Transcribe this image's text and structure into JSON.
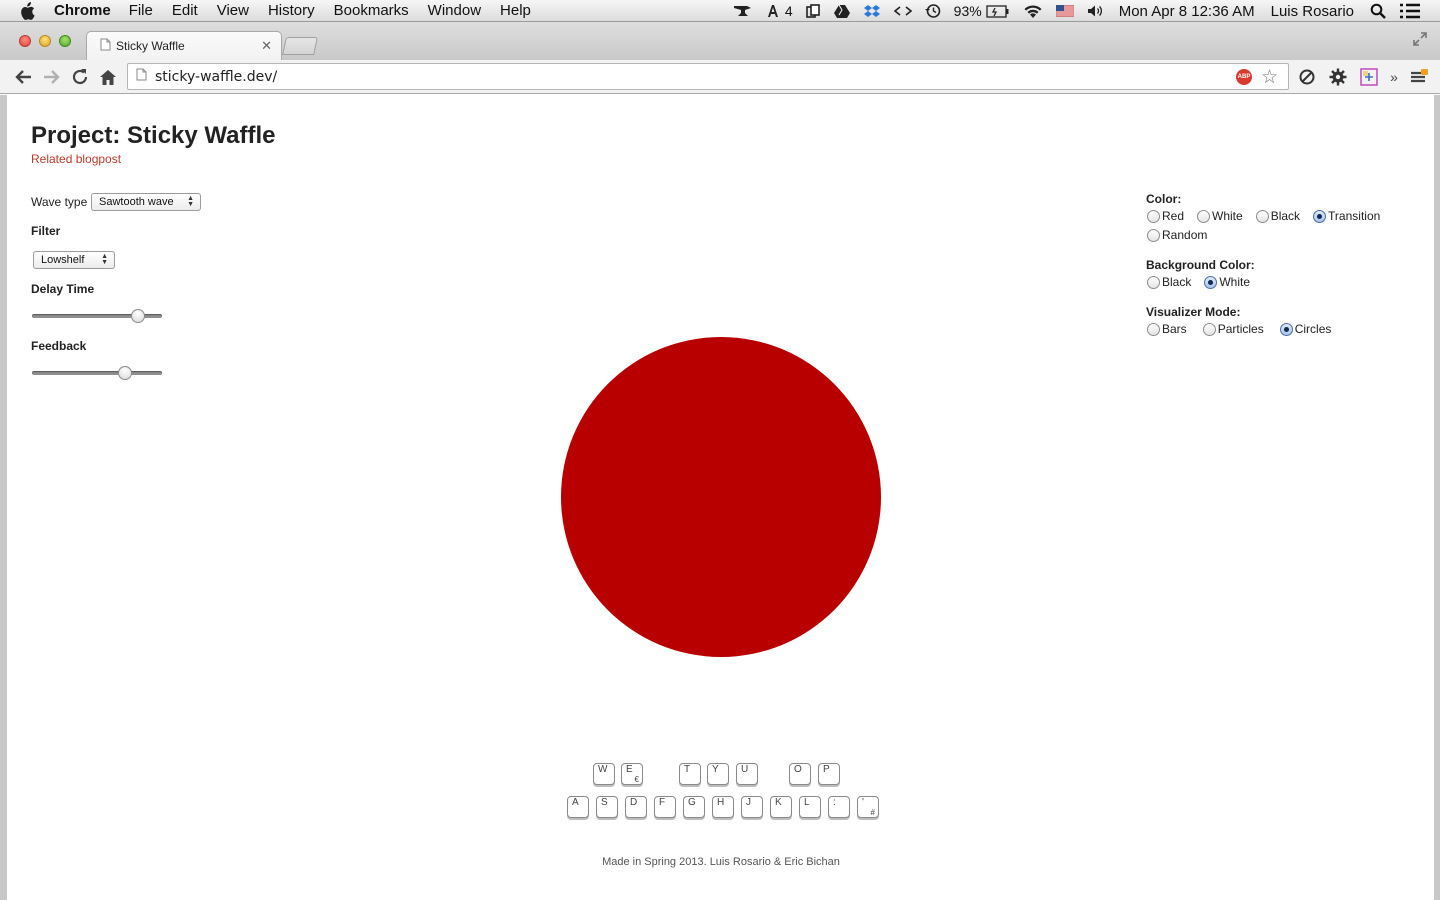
{
  "menubar": {
    "app": "Chrome",
    "items": [
      "File",
      "Edit",
      "View",
      "History",
      "Bookmarks",
      "Window",
      "Help"
    ],
    "status": {
      "adium_count": "4",
      "battery": "93%",
      "clock": "Mon Apr 8  12:36 AM",
      "user": "Luis Rosario"
    }
  },
  "browser": {
    "tab_title": "Sticky Waffle",
    "url": "sticky-waffle.dev/",
    "abp_label": "ABP"
  },
  "page": {
    "title": "Project: Sticky Waffle",
    "blog_link": "Related blogpost",
    "wave_type_label": "Wave type",
    "wave_type_value": "Sawtooth wave",
    "filter_label": "Filter",
    "filter_value": "Lowshelf",
    "delay_label": "Delay Time",
    "delay_value": 0.85,
    "feedback_label": "Feedback",
    "feedback_value": 0.74,
    "color_label": "Color:",
    "color_options": [
      "Red",
      "White",
      "Black",
      "Transition",
      "Random"
    ],
    "color_selected": "Transition",
    "bg_label": "Background Color:",
    "bg_options": [
      "Black",
      "White"
    ],
    "bg_selected": "White",
    "mode_label": "Visualizer Mode:",
    "mode_options": [
      "Bars",
      "Particles",
      "Circles"
    ],
    "mode_selected": "Circles",
    "circle_color": "#b80000",
    "keys_row1": [
      {
        "k": "W",
        "s": ""
      },
      {
        "k": "E",
        "s": "€"
      },
      {
        "k": "T",
        "s": ""
      },
      {
        "k": "Y",
        "s": ""
      },
      {
        "k": "U",
        "s": ""
      },
      {
        "k": "O",
        "s": ""
      },
      {
        "k": "P",
        "s": ""
      }
    ],
    "keys_row2": [
      {
        "k": "A",
        "s": ""
      },
      {
        "k": "S",
        "s": ""
      },
      {
        "k": "D",
        "s": ""
      },
      {
        "k": "F",
        "s": ""
      },
      {
        "k": "G",
        "s": ""
      },
      {
        "k": "H",
        "s": ""
      },
      {
        "k": "J",
        "s": ""
      },
      {
        "k": "K",
        "s": ""
      },
      {
        "k": "L",
        "s": ""
      },
      {
        "k": ":",
        "s": ""
      },
      {
        "k": "'",
        "s": "#"
      }
    ],
    "footer": "Made in Spring 2013. Luis Rosario & Eric Bichan"
  }
}
